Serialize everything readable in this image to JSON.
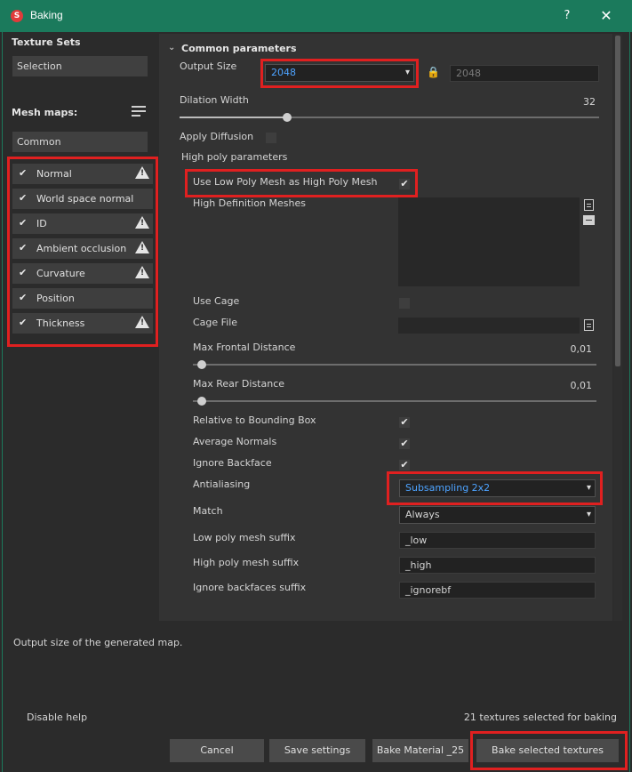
{
  "window": {
    "title": "Baking",
    "help_label": "?",
    "close_label": "✕"
  },
  "left": {
    "texture_sets_header": "Texture Sets",
    "texture_set_value": "Selection",
    "mesh_maps_header": "Mesh maps:",
    "mesh_map_group": "Common",
    "maps": [
      {
        "label": "Normal",
        "checked": true,
        "warning": true
      },
      {
        "label": "World space normal",
        "checked": true,
        "warning": false
      },
      {
        "label": "ID",
        "checked": true,
        "warning": true
      },
      {
        "label": "Ambient occlusion",
        "checked": true,
        "warning": true
      },
      {
        "label": "Curvature",
        "checked": true,
        "warning": true
      },
      {
        "label": "Position",
        "checked": true,
        "warning": false
      },
      {
        "label": "Thickness",
        "checked": true,
        "warning": true
      }
    ]
  },
  "params": {
    "section_title": "Common parameters",
    "output_size_label": "Output Size",
    "output_size_value": "2048",
    "output_size_locked_value": "2048",
    "dilation_label": "Dilation Width",
    "dilation_value": "32",
    "apply_diffusion_label": "Apply Diffusion",
    "high_poly_header": "High poly parameters",
    "use_low_poly_label": "Use Low Poly Mesh as High Poly Mesh",
    "use_low_poly_checked": true,
    "high_def_meshes_label": "High Definition Meshes",
    "use_cage_label": "Use Cage",
    "cage_file_label": "Cage File",
    "max_frontal_label": "Max Frontal Distance",
    "max_frontal_value": "0,01",
    "max_rear_label": "Max Rear Distance",
    "max_rear_value": "0,01",
    "relative_bbox_label": "Relative to Bounding Box",
    "average_normals_label": "Average Normals",
    "ignore_backface_label": "Ignore Backface",
    "antialiasing_label": "Antialiasing",
    "antialiasing_value": "Subsampling 2x2",
    "match_label": "Match",
    "match_value": "Always",
    "low_suffix_label": "Low poly mesh suffix",
    "low_suffix_value": "_low",
    "high_suffix_label": "High poly mesh suffix",
    "high_suffix_value": "_high",
    "ignore_suffix_label": "Ignore backfaces suffix",
    "ignore_suffix_value": "_ignorebf"
  },
  "help_text": "Output size of the generated map.",
  "footer": {
    "disable_help": "Disable help",
    "status": "21 textures selected for baking",
    "cancel": "Cancel",
    "save_settings": "Save settings",
    "bake_material": "Bake Material _25",
    "bake_selected": "Bake selected textures"
  },
  "colors": {
    "titlebar": "#1b7a5c",
    "highlight_box": "#e02020",
    "select_text": "#4da3ff"
  }
}
